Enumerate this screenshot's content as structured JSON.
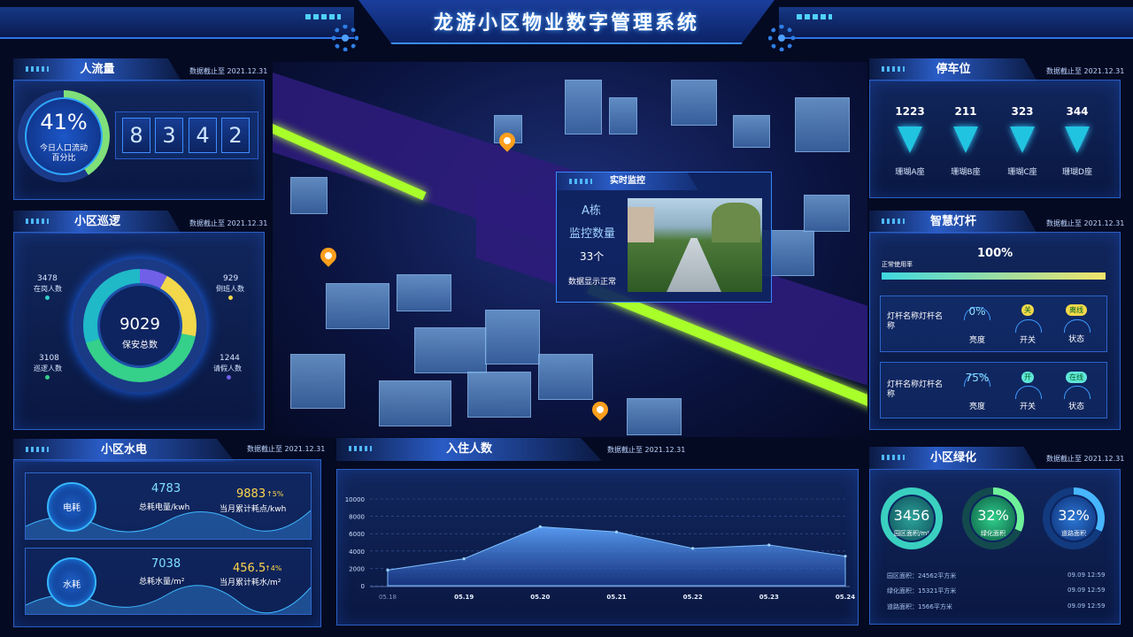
{
  "header": {
    "title": "龙游小区物业数字管理系统"
  },
  "asof": "数据截止至 2021.12.31",
  "traffic": {
    "title": "人流量",
    "percent": "41%",
    "caption1": "今日人口流动",
    "caption2": "百分比",
    "digits": [
      "8",
      "3",
      "4",
      "2"
    ]
  },
  "patrol": {
    "title": "小区巡逻",
    "center_value": "9029",
    "center_label": "保安总数",
    "stats": [
      {
        "value": "3478",
        "label": "在岗人数"
      },
      {
        "value": "929",
        "label": "倒班人数"
      },
      {
        "value": "3108",
        "label": "巡逻人数"
      },
      {
        "value": "1244",
        "label": "请假人数"
      }
    ]
  },
  "utilities": {
    "title": "小区水电",
    "power": {
      "icon_label": "电耗",
      "total": "4783",
      "total_label": "总耗电量/kwh",
      "current": "9883",
      "trend": "↑5%",
      "current_label": "当月累计耗点/kwh"
    },
    "water": {
      "icon_label": "水耗",
      "total": "7038",
      "total_label": "总耗水量/m²",
      "current": "456.5",
      "trend": "↑4%",
      "current_label": "当月累计耗水/m²"
    }
  },
  "monitor": {
    "title": "实时监控",
    "building": "A栋",
    "count_label": "监控数量",
    "count": "33个",
    "status": "数据显示正常"
  },
  "parking": {
    "title": "停车位",
    "spots": [
      {
        "value": "1223",
        "label": "珊瑚A座"
      },
      {
        "value": "211",
        "label": "珊瑚B座"
      },
      {
        "value": "323",
        "label": "珊瑚C座"
      },
      {
        "value": "344",
        "label": "珊瑚D座"
      }
    ]
  },
  "lamps": {
    "title": "智慧灯杆",
    "usage_label": "正常使用率",
    "usage_value": "100%",
    "usage_fraction": 1.0,
    "rows": [
      {
        "name": "灯杆名称灯杆名称",
        "brightness": "0%",
        "brightness_label": "亮度",
        "switch": "关",
        "switch_label": "开关",
        "status": "离线",
        "status_label": "状态"
      },
      {
        "name": "灯杆名称灯杆名称",
        "brightness": "75%",
        "brightness_label": "亮度",
        "switch": "开",
        "switch_label": "开关",
        "status": "在线",
        "status_label": "状态"
      }
    ]
  },
  "occupancy": {
    "title": "入住人数",
    "chart_data": {
      "type": "area",
      "x": [
        "05.18",
        "05.19",
        "05.20",
        "05.21",
        "05.22",
        "05.23",
        "05.24"
      ],
      "values": [
        1800,
        3100,
        6800,
        6200,
        4300,
        4700,
        3400
      ],
      "ylim": [
        0,
        10000
      ],
      "yticks": [
        "10000",
        "8000",
        "6000",
        "4000",
        "2000",
        "0"
      ],
      "grid": true
    }
  },
  "greening": {
    "title": "小区绿化",
    "rings": [
      {
        "value": "3456",
        "label": "园区面积/m²"
      },
      {
        "value": "32%",
        "label": "绿化面积"
      },
      {
        "value": "32%",
        "label": "道路面积"
      }
    ],
    "rows": [
      {
        "text": "园区面积：24562平方米",
        "time": "09.09 12:59"
      },
      {
        "text": "绿化面积：15321平方米",
        "time": "09.09 12:59"
      },
      {
        "text": "道路面积：1566平方米",
        "time": "09.09 12:59"
      }
    ]
  },
  "colors": {
    "accent": "#3b8cff",
    "road": "#a8ff2a",
    "pin": "#ff9f1c"
  }
}
